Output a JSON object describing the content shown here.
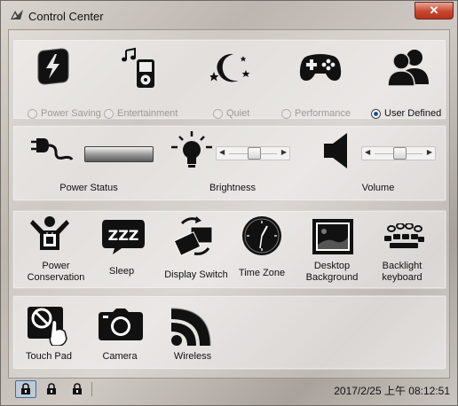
{
  "window": {
    "title": "Control Center",
    "close_label": "✕"
  },
  "modes": [
    {
      "label": "Power Saving",
      "icon": "battery-bolt-icon",
      "selected": false
    },
    {
      "label": "Entertainment",
      "icon": "music-player-icon",
      "selected": false
    },
    {
      "label": "Quiet",
      "icon": "moon-stars-icon",
      "selected": false
    },
    {
      "label": "Performance",
      "icon": "gamepad-icon",
      "selected": false
    },
    {
      "label": "User Defined",
      "icon": "users-icon",
      "selected": true
    }
  ],
  "controls": {
    "power_status": {
      "label": "Power Status"
    },
    "brightness": {
      "label": "Brightness",
      "level": 0.5
    },
    "volume": {
      "label": "Volume",
      "level": 0.5
    }
  },
  "tools": [
    {
      "label": "Power\nConservation",
      "icon": "power-conservation-icon"
    },
    {
      "label": "Sleep",
      "icon": "sleep-zzz-icon"
    },
    {
      "label": "Display Switch",
      "icon": "display-switch-icon"
    },
    {
      "label": "Time Zone",
      "icon": "clock-icon"
    },
    {
      "label": "Desktop\nBackground",
      "icon": "desktop-background-icon"
    },
    {
      "label": "Backlight\nkeyboard",
      "icon": "backlight-keyboard-icon"
    }
  ],
  "devices": [
    {
      "label": "Touch Pad",
      "icon": "touchpad-disabled-icon"
    },
    {
      "label": "Camera",
      "icon": "camera-icon"
    },
    {
      "label": "Wireless",
      "icon": "wireless-icon"
    }
  ],
  "status": {
    "datetime": "2017/2/25 上午 08:12:51"
  }
}
